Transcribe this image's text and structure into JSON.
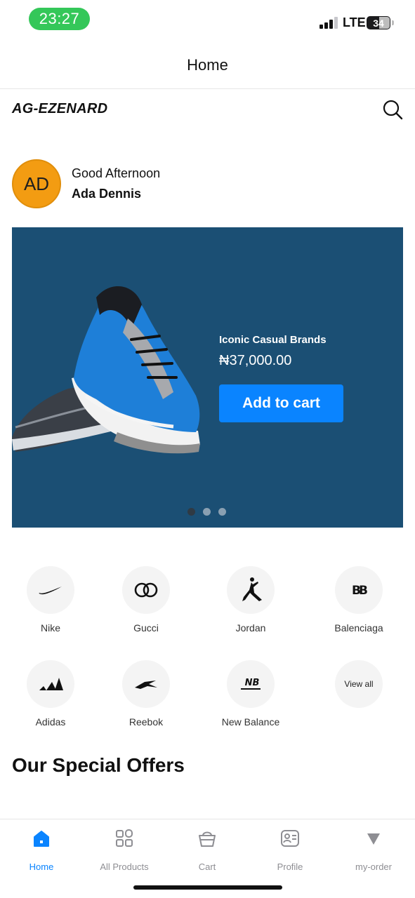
{
  "status": {
    "time": "23:27",
    "network": "LTE",
    "battery": "34"
  },
  "nav": {
    "title": "Home"
  },
  "header": {
    "brand": "AG-EZENARD",
    "search_icon": "search-icon"
  },
  "greeting": {
    "initials": "AD",
    "salutation": "Good Afternoon",
    "name": "Ada Dennis"
  },
  "banner": {
    "title": "Iconic Casual Brands",
    "price": "₦37,000.00",
    "cta": "Add to cart",
    "slide_count": 3,
    "active_slide": 1,
    "background": "#1b4f74"
  },
  "brands": [
    {
      "label": "Nike",
      "icon": "nike-logo-icon"
    },
    {
      "label": "Gucci",
      "icon": "gucci-logo-icon"
    },
    {
      "label": "Jordan",
      "icon": "jordan-logo-icon"
    },
    {
      "label": "Balenciaga",
      "icon": "balenciaga-logo-icon"
    },
    {
      "label": "Adidas",
      "icon": "adidas-logo-icon"
    },
    {
      "label": "Reebok",
      "icon": "reebok-logo-icon"
    },
    {
      "label": "New Balance",
      "icon": "new-balance-logo-icon"
    },
    {
      "label": "View all",
      "icon": ""
    }
  ],
  "sections": {
    "special_offers": "Our Special Offers"
  },
  "tabbar": {
    "items": [
      {
        "label": "Home",
        "icon": "home-icon",
        "active": true
      },
      {
        "label": "All Products",
        "icon": "grid-icon",
        "active": false
      },
      {
        "label": "Cart",
        "icon": "cart-bag-icon",
        "active": false
      },
      {
        "label": "Profile",
        "icon": "profile-card-icon",
        "active": false
      },
      {
        "label": "my-order",
        "icon": "triangle-down-icon",
        "active": false
      }
    ],
    "accent": "#0a84ff",
    "inactive": "#8e8e93"
  },
  "colors": {
    "status_green": "#34c759",
    "avatar": "#f39c12",
    "cta": "#0a84ff"
  }
}
